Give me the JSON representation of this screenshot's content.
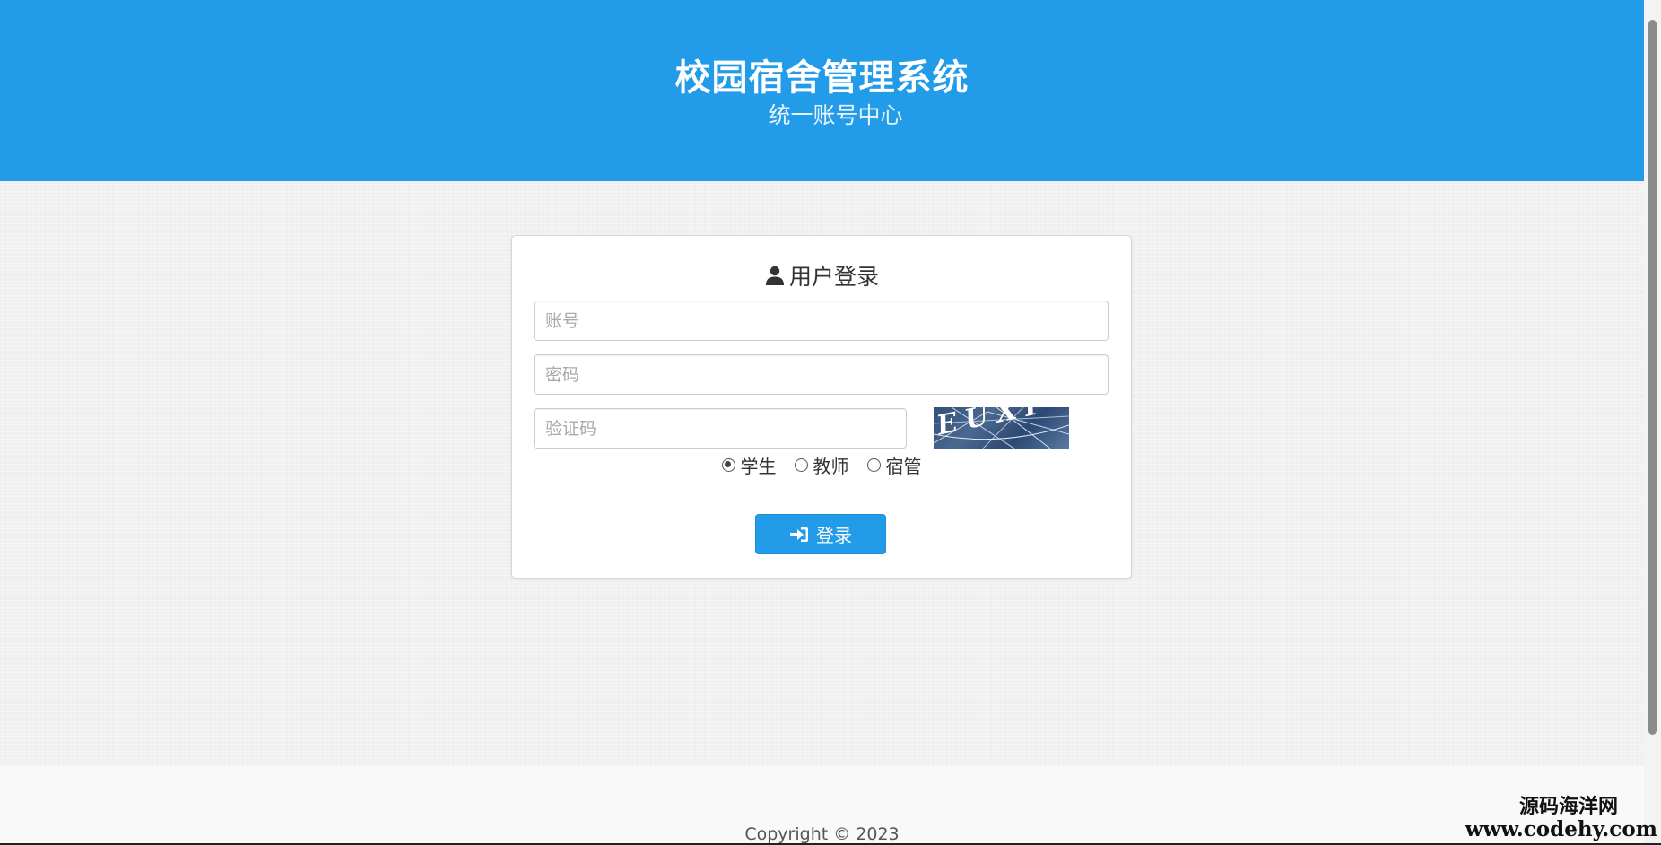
{
  "header": {
    "title": "校园宿舍管理系统",
    "subtitle": "统一账号中心"
  },
  "login": {
    "title": "用户登录",
    "user_icon": "user-icon",
    "account_placeholder": "账号",
    "password_placeholder": "密码",
    "captcha_placeholder": "验证码",
    "captcha_text": "EUXI",
    "roles": [
      {
        "label": "学生",
        "checked": true
      },
      {
        "label": "教师",
        "checked": false
      },
      {
        "label": "宿管",
        "checked": false
      }
    ],
    "button_icon": "sign-in-icon",
    "button_label": "登录"
  },
  "footer": {
    "copyright": "Copyright © 2023"
  },
  "watermark": {
    "name": "源码海洋网",
    "url": "www.codehy.com"
  },
  "colors": {
    "primary": "#229be8",
    "background": "#f1f1f1"
  }
}
